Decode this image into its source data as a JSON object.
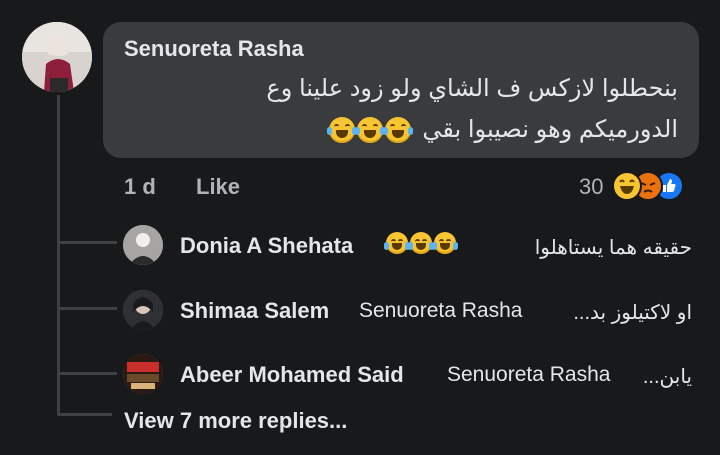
{
  "comment": {
    "author": "Senuoreta Rasha",
    "text_line1": "بنحطلوا لازكس ف الشاي ولو زود علينا وع",
    "text_line2": "الدورميكم وهو نصيبوا بقي",
    "emoji": "laughing-tears-emoji",
    "time": "1 d",
    "like_label": "Like",
    "reaction_count": "30",
    "reaction_icons": [
      "haha-reaction-icon",
      "angry-reaction-icon",
      "like-reaction-icon"
    ]
  },
  "replies": [
    {
      "name": "Donia A Shehata",
      "text": "حقيقه هما يستاهلوا",
      "mention": ""
    },
    {
      "name": "Shimaa Salem",
      "mention": "Senuoreta Rasha",
      "text": "او لاكتيلوز بد..."
    },
    {
      "name": "Abeer Mohamed Said",
      "mention": "Senuoreta Rasha",
      "text": "يابن..."
    }
  ],
  "view_more": "View 7 more replies...",
  "colors": {
    "background": "#18191a",
    "bubble": "#3a3b3c",
    "text": "#e4e6eb",
    "secondary_text": "#b0b3b8",
    "like_blue": "#1877f2",
    "haha_yellow": "#f7c531",
    "angry_orange": "#e9710f"
  }
}
